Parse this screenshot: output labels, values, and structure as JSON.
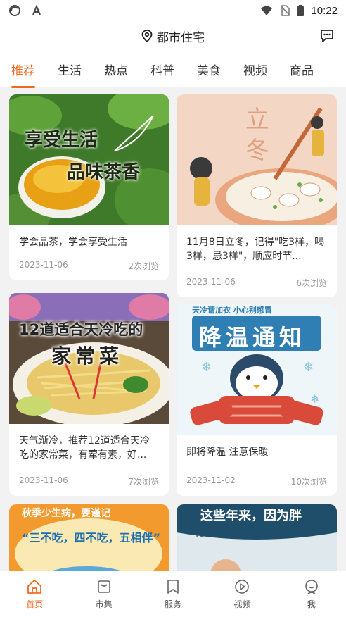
{
  "status_bar": {
    "time": "10:22"
  },
  "header": {
    "location": "都市住宅"
  },
  "tabs": [
    {
      "label": "推荐"
    },
    {
      "label": "生活"
    },
    {
      "label": "热点"
    },
    {
      "label": "科普"
    },
    {
      "label": "美食"
    },
    {
      "label": "视频"
    },
    {
      "label": "商品"
    }
  ],
  "cards": [
    {
      "image_text_1": "享受生活",
      "image_text_2": "品味茶香",
      "title": "学会品茶，学会享受生活",
      "date": "2023-11-06",
      "views": "2次浏览"
    },
    {
      "image_text_1": "立",
      "image_text_2": "冬",
      "title": "11月8日立冬，记得\"吃3样，喝3样，忌3样\"，顺应时节...",
      "date": "2023-11-06",
      "views": "6次浏览"
    },
    {
      "image_text_1": "12道适合天冷吃的",
      "image_text_2": "家常菜",
      "title": "天气渐冷，推荐12道适合天冷吃的家常菜，有荤有素，好...",
      "date": "2023-11-06",
      "views": "7次浏览"
    },
    {
      "image_text_top": "天冷请加衣  小心别感冒",
      "image_text_1": "降温通知",
      "title": "即将降温 注意保暖",
      "date": "2023-11-02",
      "views": "10次浏览"
    },
    {
      "image_text_1": "秋季少生病，要谨记",
      "image_text_2": "“三不吃，四不吃，五相伴”"
    },
    {
      "image_text_1": "这些年来，因为胖",
      "image_text_2": "你误会了多少漂亮衣服"
    }
  ],
  "bottom_nav": [
    {
      "label": "首页",
      "icon": "home-icon"
    },
    {
      "label": "市集",
      "icon": "market-icon"
    },
    {
      "label": "服务",
      "icon": "service-icon"
    },
    {
      "label": "视频",
      "icon": "video-icon"
    },
    {
      "label": "我",
      "icon": "profile-icon"
    }
  ],
  "colors": {
    "accent": "#f26a21",
    "background": "#f2f2f2"
  }
}
